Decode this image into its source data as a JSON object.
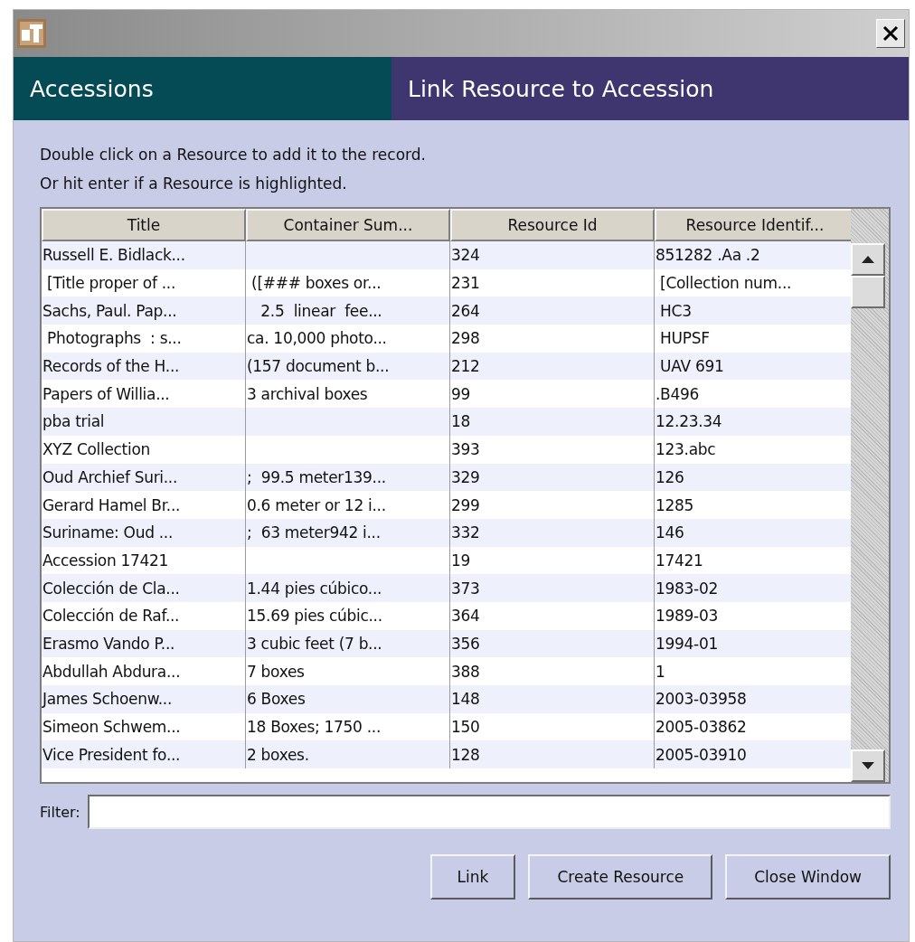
{
  "header": {
    "module": "Accessions",
    "title": "Link Resource to Accession"
  },
  "instructions": [
    "Double click on a Resource to add it to the record.",
    "Or hit enter if a Resource is highlighted."
  ],
  "table": {
    "columns": [
      "Title",
      "Container Sum...",
      "Resource Id",
      "Resource Identif..."
    ],
    "rows": [
      [
        "Russell E. Bidlack...",
        "",
        "324",
        "851282 .Aa .2"
      ],
      [
        " [Title proper of ...",
        " ([### boxes or...",
        "231",
        " [Collection num..."
      ],
      [
        "Sachs, Paul. Pap...",
        "   2.5  linear  fee...",
        "264",
        " HC3"
      ],
      [
        " Photographs  : s...",
        "ca. 10,000 photo...",
        "298",
        " HUPSF"
      ],
      [
        "Records of the H...",
        "(157 document b...",
        "212",
        " UAV 691"
      ],
      [
        "Papers of Willia...",
        "3 archival boxes",
        "99",
        ".B496"
      ],
      [
        "pba trial",
        "",
        "18",
        "12.23.34"
      ],
      [
        "XYZ Collection",
        "",
        "393",
        "123.abc"
      ],
      [
        "Oud Archief Suri...",
        ";  99.5 meter139...",
        "329",
        "126"
      ],
      [
        "Gerard Hamel Br...",
        "0.6 meter or 12 i...",
        "299",
        "1285"
      ],
      [
        "Suriname: Oud ...",
        ";  63 meter942 i...",
        "332",
        "146"
      ],
      [
        "Accession 17421",
        "",
        "19",
        "17421"
      ],
      [
        "Colección de Cla...",
        "1.44 pies cúbico...",
        "373",
        "1983-02"
      ],
      [
        "Colección de Raf...",
        "15.69 pies cúbic...",
        "364",
        "1989-03"
      ],
      [
        "Erasmo Vando P...",
        "3 cubic feet (7 b...",
        "356",
        "1994-01"
      ],
      [
        "Abdullah Abdura...",
        "7 boxes",
        "388",
        "1"
      ],
      [
        "James Schoenw...",
        "6 Boxes",
        "148",
        "2003-03958"
      ],
      [
        "Simeon Schwem...",
        "18 Boxes; 1750 ...",
        "150",
        "2005-03862"
      ],
      [
        "Vice President fo...",
        "2 boxes.",
        "128",
        "2005-03910"
      ]
    ]
  },
  "filter": {
    "label": "Filter:"
  },
  "buttons": [
    "Link",
    "Create Resource",
    "Close Window"
  ]
}
